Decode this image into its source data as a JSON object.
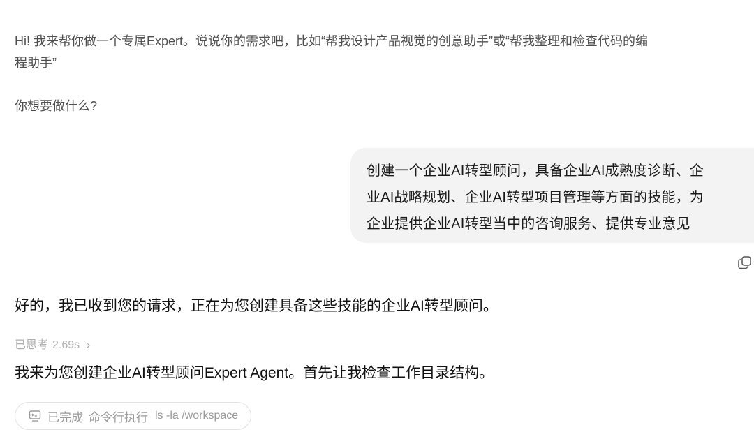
{
  "welcome": {
    "line1": "Hi! 我来帮你做一个专属Expert。说说你的需求吧，比如“帮我设计产品视觉的创意助手”或“帮我整理和检查代码的编",
    "line2": "程助手”",
    "question": "你想要做什么?"
  },
  "user_message": {
    "line1": "创建一个企业AI转型顾问，具备企业AI成熟度诊断、企",
    "line2": "业AI战略规划、企业AI转型项目管理等方面的技能，为",
    "line3": "企业提供企业AI转型当中的咨询服务、提供专业意见"
  },
  "copy_icon": "copy-icon",
  "assistant": {
    "reply": "好的，我已收到您的请求，正在为您创建具备这些技能的企业AI转型顾问。",
    "thought_label": "已思考",
    "thought_time": "2.69s",
    "thought_chevron": "›",
    "plan": "我来为您创建企业AI转型顾问Expert Agent。首先让我检查工作目录结构。"
  },
  "tool_call": {
    "icon": "terminal-icon",
    "status": "已完成",
    "action": "命令行执行",
    "command": "ls -la /workspace"
  }
}
